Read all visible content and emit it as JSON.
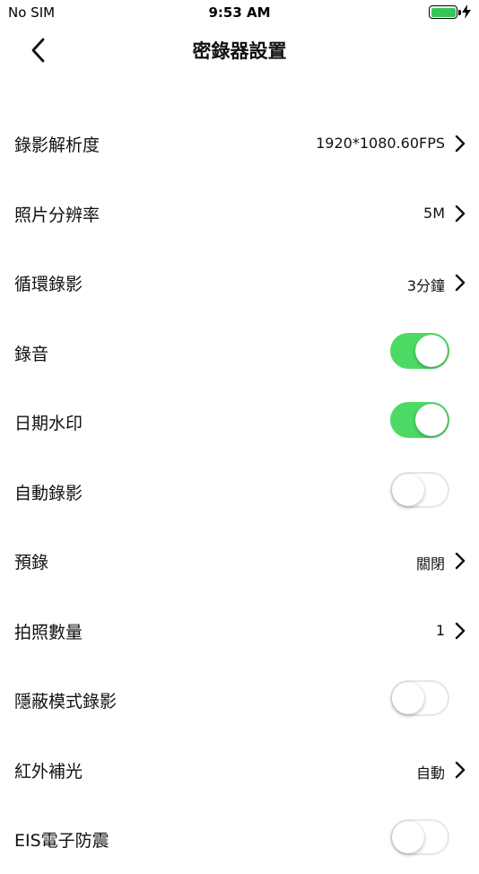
{
  "status_bar": {
    "carrier": "No SIM",
    "time": "9:53 AM",
    "battery_color": "#34c759"
  },
  "nav": {
    "back_icon": "chevron-left-icon",
    "title": "密錄器設置"
  },
  "settings": [
    {
      "label": "錄影解析度",
      "type": "value",
      "value": "1920*1080.60FPS"
    },
    {
      "label": "照片分辨率",
      "type": "value",
      "value": "5M"
    },
    {
      "label": "循環錄影",
      "type": "value",
      "value": "3分鐘"
    },
    {
      "label": "錄音",
      "type": "toggle",
      "on": true
    },
    {
      "label": "日期水印",
      "type": "toggle",
      "on": true
    },
    {
      "label": "自動錄影",
      "type": "toggle",
      "on": false
    },
    {
      "label": "預錄",
      "type": "value",
      "value": "關閉"
    },
    {
      "label": "拍照數量",
      "type": "value",
      "value": "1"
    },
    {
      "label": "隱蔽模式錄影",
      "type": "toggle",
      "on": false
    },
    {
      "label": "紅外補光",
      "type": "value",
      "value": "自動"
    },
    {
      "label": "EIS電子防震",
      "type": "toggle",
      "on": false
    }
  ],
  "colors": {
    "toggle_on": "#4cd964",
    "toggle_off_border": "#e6e6e6"
  }
}
